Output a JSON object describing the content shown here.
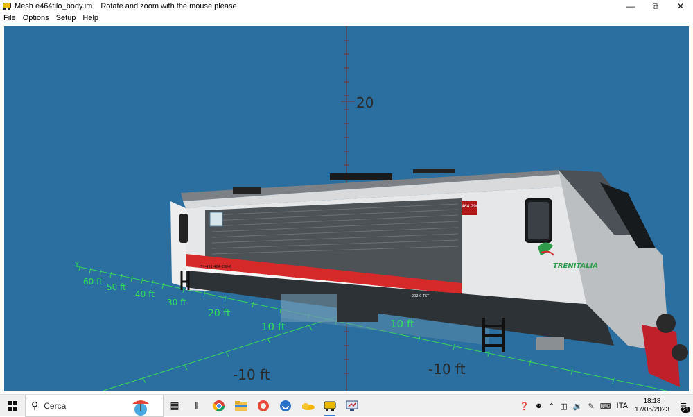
{
  "window": {
    "title": "Mesh e464tilo_body.im",
    "hint": "Rotate and zoom with the mouse please.",
    "minimize_icon": "minimize-icon",
    "maximize_icon": "restore-icon",
    "close_icon": "close-icon"
  },
  "menu": [
    "File",
    "Options",
    "Setup",
    "Help"
  ],
  "viewport": {
    "background": "#2a6fa0",
    "axis_z_label": "20",
    "axis_y_letter": "Y",
    "axis_left_labels": [
      "60 ft",
      "50 ft",
      "40 ft",
      "30 ft",
      "20 ft",
      "10 ft"
    ],
    "axis_right_labels": [
      "10 ft"
    ],
    "neg_labels": [
      "-10 ft",
      "-10 ft"
    ],
    "loco": {
      "number_plate": "464.290",
      "brand": "TRENITALIA",
      "side_text_1": "IT-I-491 464-290-6",
      "side_text_2": "202 0 TST"
    }
  },
  "taskbar": {
    "search_placeholder": "Cerca",
    "language": "ITA",
    "time": "18:18",
    "date": "17/05/2023",
    "notification_count": "21"
  }
}
